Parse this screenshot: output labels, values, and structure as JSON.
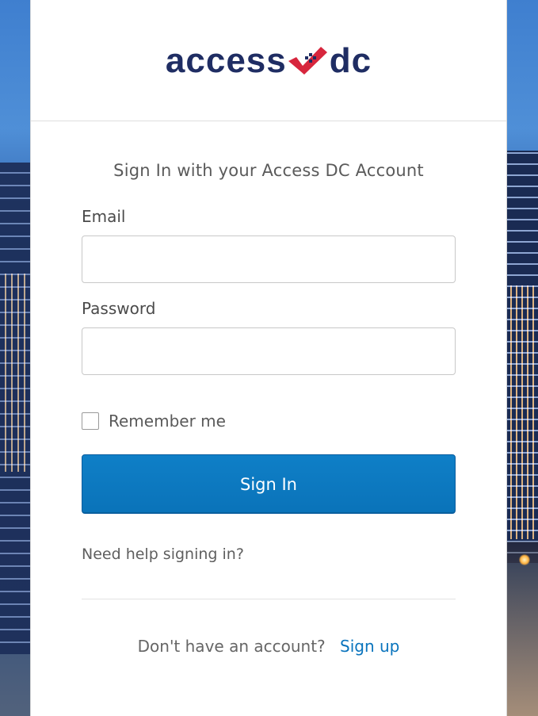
{
  "brand": {
    "logo_left": "access",
    "logo_right": "dc",
    "primary_color": "#1f2d63",
    "accent_color": "#d7263d",
    "checkmark_icon": "checkmark-logo-icon"
  },
  "form": {
    "title": "Sign In with your Access DC Account",
    "email_label": "Email",
    "email_value": "",
    "password_label": "Password",
    "password_value": "",
    "remember_label": "Remember me",
    "remember_checked": false,
    "signin_label": "Sign In",
    "help_link": "Need help signing in?"
  },
  "footer": {
    "question": "Don't have an account?",
    "signup_link": "Sign up"
  },
  "colors": {
    "button": "#0a73b9",
    "link": "#0a74bd"
  }
}
